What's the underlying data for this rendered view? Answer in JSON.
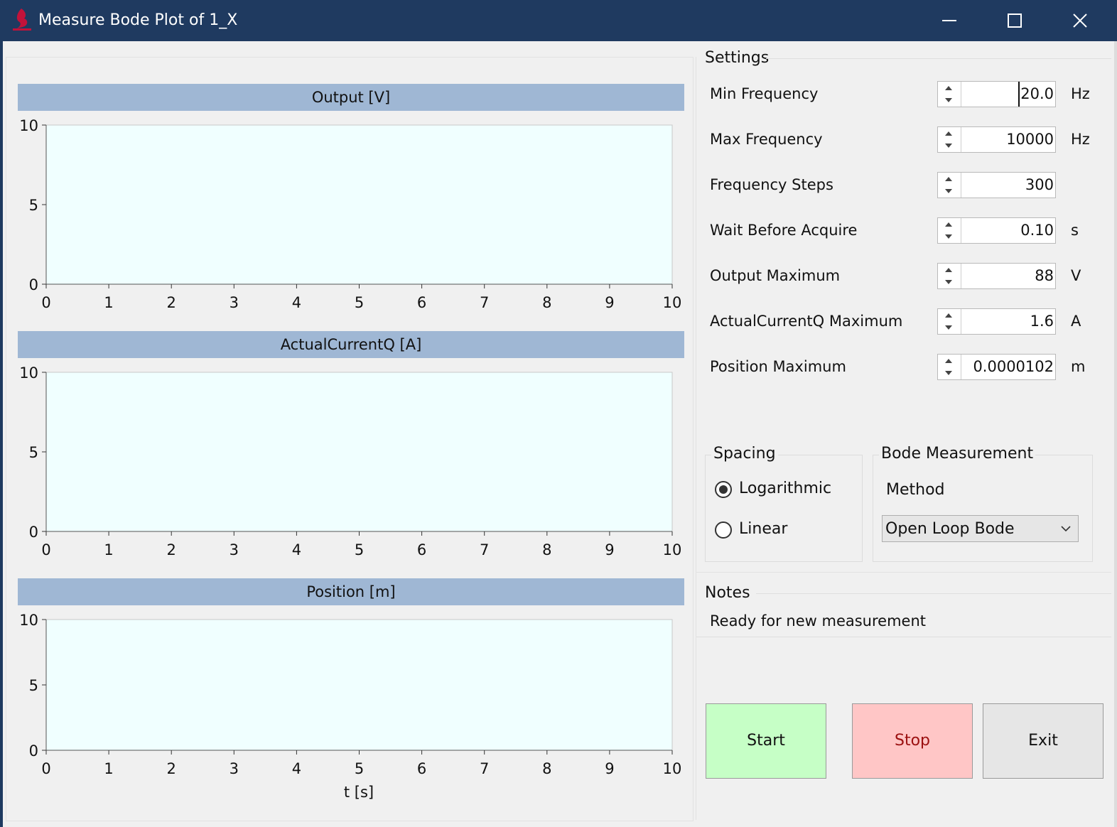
{
  "window": {
    "title": "Measure Bode Plot of 1_X",
    "colors": {
      "titlebar": "#1f3a60",
      "plot_header": "#9fb7d4",
      "plot_bg": "#f0ffff"
    }
  },
  "plots": [
    {
      "title": "Output [V]"
    },
    {
      "title": "ActualCurrentQ [A]"
    },
    {
      "title": "Position [m]"
    }
  ],
  "chart_data": [
    {
      "type": "line",
      "title": "Output [V]",
      "xlim": [
        0,
        10
      ],
      "ylim": [
        0,
        10
      ],
      "xticks": [
        "0",
        "1",
        "2",
        "3",
        "4",
        "5",
        "6",
        "7",
        "8",
        "9",
        "10"
      ],
      "yticks": [
        "0",
        "5",
        "10"
      ],
      "series": []
    },
    {
      "type": "line",
      "title": "ActualCurrentQ [A]",
      "xlim": [
        0,
        10
      ],
      "ylim": [
        0,
        10
      ],
      "xticks": [
        "0",
        "1",
        "2",
        "3",
        "4",
        "5",
        "6",
        "7",
        "8",
        "9",
        "10"
      ],
      "yticks": [
        "0",
        "5",
        "10"
      ],
      "series": []
    },
    {
      "type": "line",
      "title": "Position [m]",
      "xlabel": "t [s]",
      "xlim": [
        0,
        10
      ],
      "ylim": [
        0,
        10
      ],
      "xticks": [
        "0",
        "1",
        "2",
        "3",
        "4",
        "5",
        "6",
        "7",
        "8",
        "9",
        "10"
      ],
      "yticks": [
        "0",
        "5",
        "10"
      ],
      "series": []
    }
  ],
  "xaxis_label": "t [s]",
  "settings": {
    "title": "Settings",
    "rows": [
      {
        "label": "Min Frequency",
        "value": "20.0",
        "unit": "Hz"
      },
      {
        "label": "Max Frequency",
        "value": "10000",
        "unit": "Hz"
      },
      {
        "label": "Frequency Steps",
        "value": "300",
        "unit": ""
      },
      {
        "label": "Wait Before Acquire",
        "value": "0.10",
        "unit": "s"
      },
      {
        "label": "Output Maximum",
        "value": "88",
        "unit": "V"
      },
      {
        "label": "ActualCurrentQ Maximum",
        "value": "1.6",
        "unit": "A"
      },
      {
        "label": "Position Maximum",
        "value": "0.0000102",
        "unit": "m"
      }
    ]
  },
  "spacing": {
    "title": "Spacing",
    "options": [
      {
        "label": "Logarithmic",
        "selected": true
      },
      {
        "label": "Linear",
        "selected": false
      }
    ]
  },
  "bode": {
    "title": "Bode Measurement",
    "method_label": "Method",
    "method_value": "Open Loop Bode"
  },
  "notes": {
    "title": "Notes",
    "text": "Ready for new measurement"
  },
  "buttons": {
    "start": {
      "label": "Start",
      "bg": "#c6ffc6",
      "color": "#111111"
    },
    "stop": {
      "label": "Stop",
      "bg": "#ffc6c6",
      "color": "#9b1010"
    },
    "exit": {
      "label": "Exit",
      "bg": "#e6e6e6",
      "color": "#111111"
    }
  }
}
